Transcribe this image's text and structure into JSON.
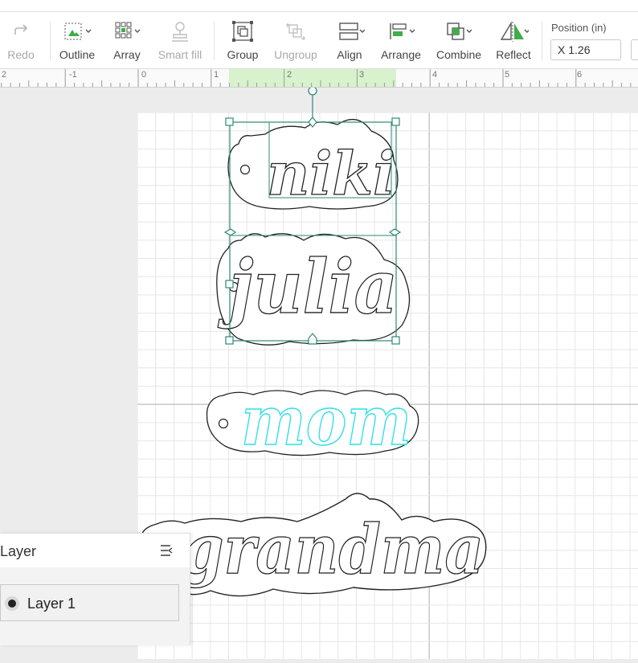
{
  "toolbar": {
    "redo_label": "Redo",
    "outline_label": "Outline",
    "array_label": "Array",
    "smart_fill_label": "Smart fill",
    "group_label": "Group",
    "ungroup_label": "Ungroup",
    "align_label": "Align",
    "arrange_label": "Arrange",
    "combine_label": "Combine",
    "reflect_label": "Reflect"
  },
  "position": {
    "title": "Position (in)",
    "x_value": "X 1.26"
  },
  "ruler": {
    "labels": [
      "2",
      "-1",
      "0",
      "1",
      "2",
      "3",
      "4",
      "5",
      "6"
    ]
  },
  "canvas": {
    "words": [
      "niki",
      "julia",
      "mom",
      "grandma"
    ]
  },
  "layers_panel": {
    "title": "Layer",
    "layer_name": "Layer 1"
  },
  "colors": {
    "selection": "#2b8a74",
    "highlight_text": "#31e0e6",
    "ruler_highlight": "#d7f2cc"
  }
}
